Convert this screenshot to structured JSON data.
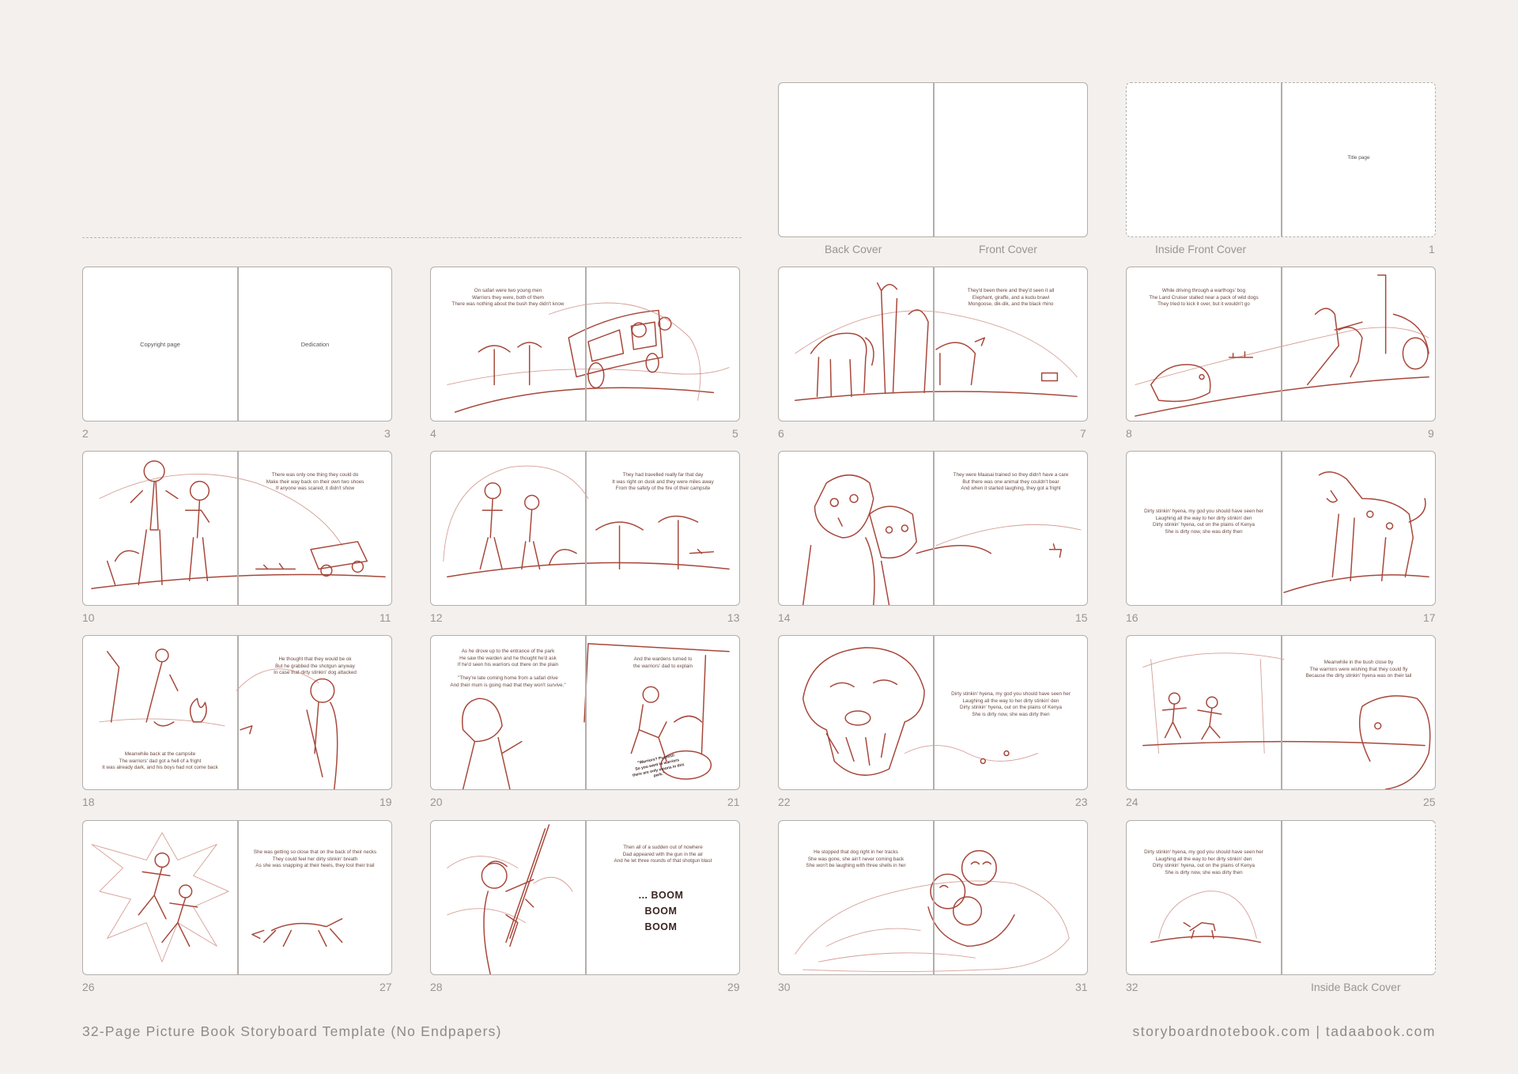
{
  "top_spreads": {
    "covers": {
      "back_label": "Back Cover",
      "front_label": "Front Cover"
    },
    "inside_front": {
      "left_label": "Inside Front Cover",
      "title_page_text": "Title page",
      "page_number": "1"
    }
  },
  "spreads": [
    {
      "left_num": "2",
      "right_num": "3",
      "left_label": "Copyright page",
      "right_label": "Dedication"
    },
    {
      "left_num": "4",
      "right_num": "5",
      "left_text": "On safari were two young men\nWarriors they were, both of them\nThere was nothing about the bush they didn't know"
    },
    {
      "left_num": "6",
      "right_num": "7",
      "right_text": "They'd been there and they'd seen it all\nElephant, giraffe, and a kudu brawl\nMongoose, dik-dik, and the black rhino"
    },
    {
      "left_num": "8",
      "right_num": "9",
      "left_text": "While driving through a warthogs' bog\nThe Land Cruiser stalled near a pack of wild dogs\nThey tried to kick it over, but it wouldn't go"
    },
    {
      "left_num": "10",
      "right_num": "11",
      "right_text": "There was only one thing they could do\nMake their way back on their own two shoes\nIf anyone was scared, it didn't show"
    },
    {
      "left_num": "12",
      "right_num": "13",
      "right_text": "They had travelled really far that day\nIt was right on dusk and they were miles away\nFrom the safety of the fire of their campsite"
    },
    {
      "left_num": "14",
      "right_num": "15",
      "right_text": "They were Maasai trained so they didn't have a care\nBut there was one animal they couldn't bear\nAnd when it started laughing, they got a fright"
    },
    {
      "left_num": "16",
      "right_num": "17",
      "left_text": "Dirty stinkin' hyena, my god you should have seen her\nLaughing all the way to her dirty stinkin' den\nDirty stinkin' hyena, out on the plains of Kenya\nShe is dirty now, she was dirty then"
    },
    {
      "left_num": "18",
      "right_num": "19",
      "right_text": "He thought that they would be ok\nBut he grabbed the shotgun anyway\nIn case that dirty stinkin' dog attacked",
      "left_text": "Meanwhile back at the campsite\nThe warriors' dad got a hell of a fright\nIt was already dark, and his boys had not come back"
    },
    {
      "left_num": "20",
      "right_num": "21",
      "left_text": "As he drove up to the entrance of the park\nHe saw the warden and he thought he'd ask\nIf he'd seen his warriors out there on the plain\n\n\"They're late coming home from a safari drive\nAnd their mum is going mad that they won't survive.\"",
      "right_text": "And the wardens turned to\nthe warriors' dad to explain",
      "bubble_text": "\"Warriors? Pssssst!\nSo you want to warriors\nthere are only moons in this park.\""
    },
    {
      "left_num": "22",
      "right_num": "23",
      "right_text": "Dirty stinkin' hyena, my god you should have seen her\nLaughing all the way to her dirty stinkin' den\nDirty stinkin' hyena, out on the plains of Kenya\nShe is dirty now, she was dirty then"
    },
    {
      "left_num": "24",
      "right_num": "25",
      "right_text": "Meanwhile in the bush close by\nThe warriors were wishing that they could fly\nBecause the dirty stinkin' hyena was on their tail"
    },
    {
      "left_num": "26",
      "right_num": "27",
      "right_text": "She was getting so close that on the back of their necks\nThey could feel her dirty stinkin' breath\nAs she was snapping at their heels, they lost their trail"
    },
    {
      "left_num": "28",
      "right_num": "29",
      "right_text": "Then all of a sudden out of nowhere\nDad appeared with the gun in the air\nAnd he let three rounds of that shotgun blast",
      "boom_text": "... BOOM\nBOOM\nBOOM"
    },
    {
      "left_num": "30",
      "right_num": "31",
      "left_text": "He stopped that dog right in her tracks\nShe was gone, she ain't never coming back\nShe won't be laughing with three shells in her"
    },
    {
      "left_num": "32",
      "right_label_below": "Inside Back Cover",
      "left_text": "Dirty stinkin' hyena, my god you should have seen her\nLaughing all the way to her dirty stinkin' den\nDirty stinkin' hyena, out on the plains of Kenya\nShe is dirty now, she was dirty then"
    }
  ],
  "footer": {
    "left": "32-Page Picture Book Storyboard Template (No Endpapers)",
    "right": "storyboardnotebook.com  |  tadaabook.com"
  },
  "colors": {
    "background": "#f3f0ed",
    "sketch": "#a7473a",
    "border": "#b3aeaa",
    "label": "#9a9591"
  }
}
